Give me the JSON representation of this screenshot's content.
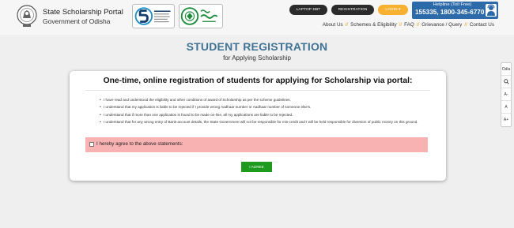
{
  "header": {
    "portal_title": "State Scholarship Portal",
    "portal_subtitle": "Government of Odisha",
    "logos": [
      "state-emblem",
      "5t-logo",
      "mo-sarkar-logo"
    ],
    "buttons": {
      "laptop": "LAPTOP DBT",
      "registration": "REGISTRATION",
      "login": "LOGIN ▾"
    },
    "helpline": {
      "label": "Helpline (Toll Free)",
      "numbers": "155335, 1800-345-6770",
      "icon": "helpline-person-icon"
    },
    "nav": [
      "About Us",
      "Schemes & Eligibility",
      "FAQ",
      "Grievance / Query",
      "Contact Us"
    ]
  },
  "page": {
    "title": "STUDENT REGISTRATION",
    "subtitle": "for Applying Scholarship"
  },
  "sidebar": {
    "items": [
      {
        "label": "Odia",
        "icon": "odia-lang-icon"
      },
      {
        "label": "",
        "icon": "search-icon"
      },
      {
        "label": "A-",
        "icon": "font-decrease-icon"
      },
      {
        "label": "A",
        "icon": "font-reset-icon"
      },
      {
        "label": "A+",
        "icon": "font-increase-icon"
      }
    ]
  },
  "card": {
    "title": "One-time, online registration of students for applying for Scholarship via portal:",
    "statements": [
      "I have read and understood the eligibility and other conditions of award of Scholarship as per the scheme guidelines.",
      "I understand that my application is liable to be rejected if I provide wrong Aadhaar number or Aadhaar number of someone else's.",
      "I understand that if more than one application is found to be made on-line, all my applications are liable to be rejected.",
      "I understand that for any wrong entry of Bank-account details, the State Government will not be responsible for mis-credit and I will be held responsible for diversion of public money on this ground."
    ],
    "agree_label": "I hereby agree to the above statements:",
    "agree_checked": false,
    "button_label": "I AGREE"
  },
  "colors": {
    "title_blue": "#3f7395",
    "helpline_blue": "#2d6aa9",
    "login_orange": "#f7b030",
    "agree_band": "#f9b2b2",
    "agree_button": "#1e9a1e"
  }
}
